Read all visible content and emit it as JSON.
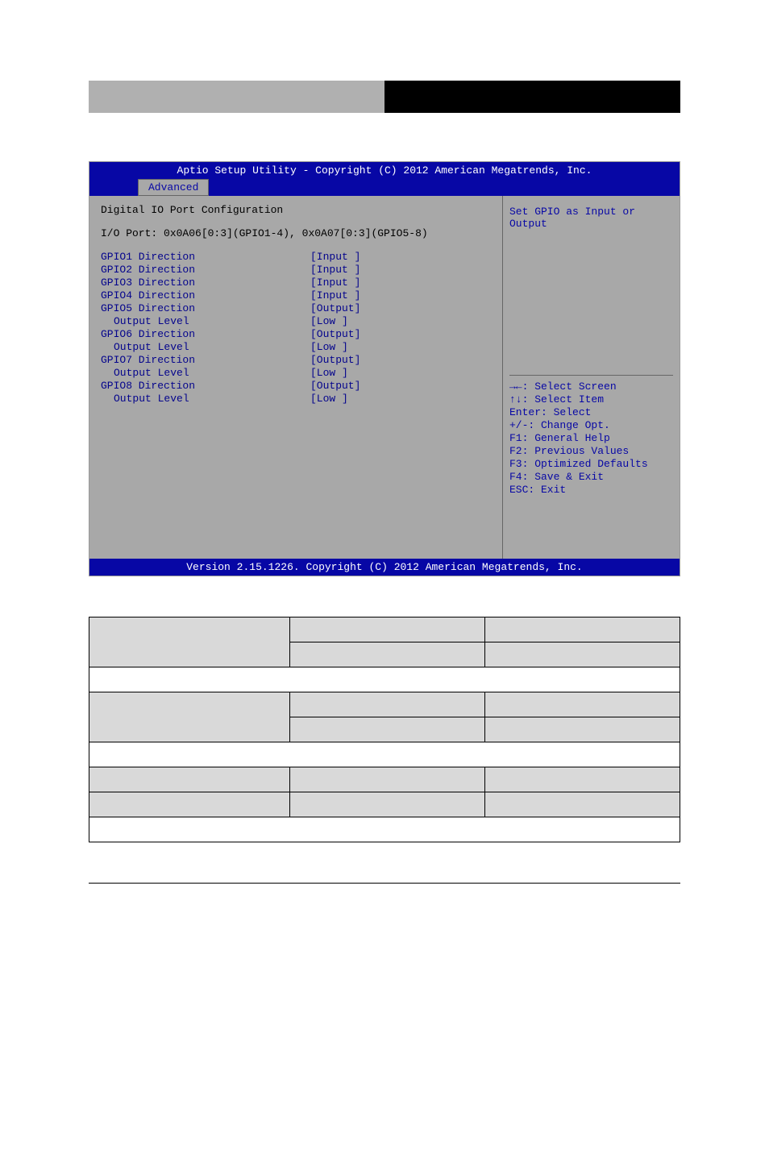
{
  "bios": {
    "topline": "Aptio Setup Utility - Copyright (C) 2012 American Megatrends, Inc.",
    "tab": "Advanced",
    "title": "Digital IO Port Configuration",
    "ioport": "I/O Port: 0x0A06[0:3](GPIO1-4), 0x0A07[0:3](GPIO5-8)",
    "rows": [
      {
        "label": "GPIO1  Direction",
        "value": "[Input ]",
        "indent": false
      },
      {
        "label": "GPIO2  Direction",
        "value": "[Input ]",
        "indent": false
      },
      {
        "label": "GPIO3  Direction",
        "value": "[Input ]",
        "indent": false
      },
      {
        "label": "GPIO4  Direction",
        "value": "[Input ]",
        "indent": false
      },
      {
        "label": "GPIO5  Direction",
        "value": "[Output]",
        "indent": false
      },
      {
        "label": "Output Level",
        "value": "[Low   ]",
        "indent": true
      },
      {
        "label": "GPIO6  Direction",
        "value": "[Output]",
        "indent": false
      },
      {
        "label": "Output Level",
        "value": "[Low   ]",
        "indent": true
      },
      {
        "label": "GPIO7  Direction",
        "value": "[Output]",
        "indent": false
      },
      {
        "label": "Output Level",
        "value": "[Low   ]",
        "indent": true
      },
      {
        "label": "GPIO8  Direction",
        "value": "[Output]",
        "indent": false
      },
      {
        "label": "Output Level",
        "value": "[Low   ]",
        "indent": true
      }
    ],
    "help": "Set GPIO as Input or Output",
    "keys": [
      "→←: Select Screen",
      "↑↓: Select Item",
      "Enter: Select",
      "+/-: Change Opt.",
      "F1: General Help",
      "F2: Previous Values",
      "F3: Optimized Defaults",
      "F4: Save & Exit",
      "ESC: Exit"
    ],
    "bottomline": "Version 2.15.1226. Copyright (C) 2012 American Megatrends, Inc."
  },
  "table": {
    "rows": [
      {
        "c1": "",
        "c2": "",
        "c3": "",
        "shaded": [
          true,
          true,
          true
        ]
      },
      {
        "c1": "",
        "c2": "",
        "c3": "",
        "shaded": [
          true,
          true,
          true
        ],
        "mergeLeft": true
      },
      {
        "c1": "",
        "c2": "",
        "c3": "",
        "shaded": [
          false,
          false,
          false
        ],
        "span": true
      },
      {
        "c1": "",
        "c2": "",
        "c3": "",
        "shaded": [
          true,
          true,
          true
        ]
      },
      {
        "c1": "",
        "c2": "",
        "c3": "",
        "shaded": [
          true,
          true,
          true
        ],
        "mergeLeft": true
      },
      {
        "c1": "",
        "c2": "",
        "c3": "",
        "shaded": [
          false,
          false,
          false
        ],
        "span": true
      },
      {
        "c1": "",
        "c2": "",
        "c3": "",
        "shaded": [
          true,
          true,
          true
        ]
      },
      {
        "c1": "",
        "c2": "",
        "c3": "",
        "shaded": [
          true,
          true,
          true
        ]
      },
      {
        "c1": "",
        "c2": "",
        "c3": "",
        "shaded": [
          false,
          false,
          false
        ],
        "span": true
      }
    ]
  }
}
